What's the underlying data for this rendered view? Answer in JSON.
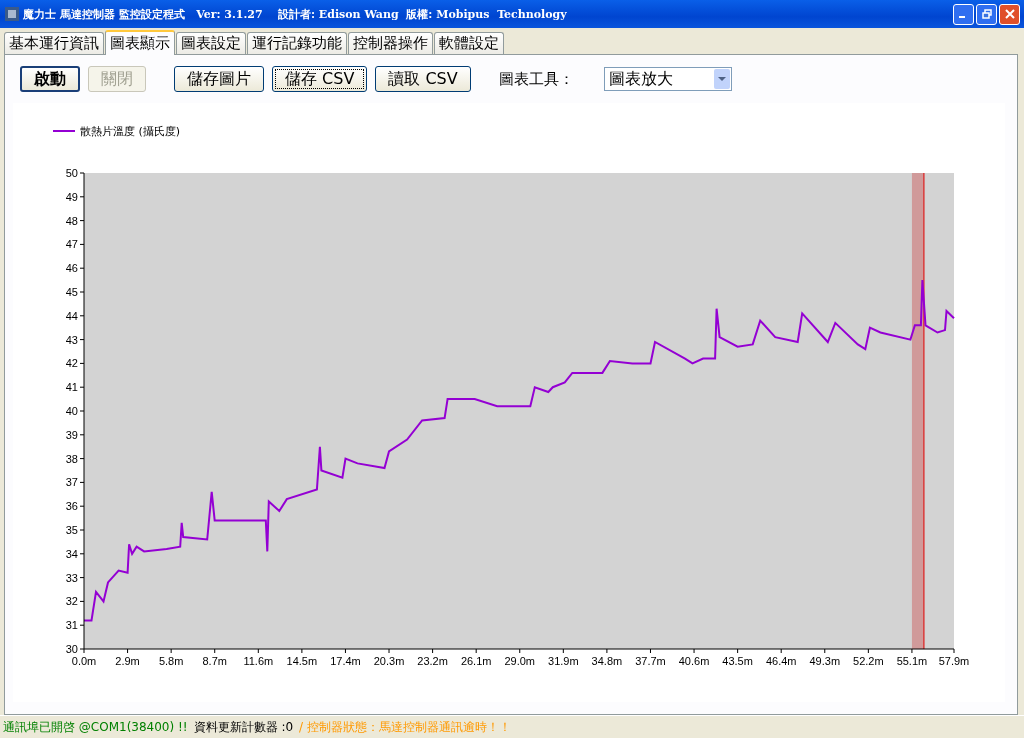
{
  "window": {
    "title": "魔力士 馬達控制器 監控設定程式   Ver: 3.1.27    設計者: Edison Wang  版權: Mobipus  Technology"
  },
  "tabs": [
    {
      "label": "基本運行資訊",
      "selected": false
    },
    {
      "label": "圖表顯示",
      "selected": true
    },
    {
      "label": "圖表設定",
      "selected": false
    },
    {
      "label": "運行記錄功能",
      "selected": false
    },
    {
      "label": "控制器操作",
      "selected": false
    },
    {
      "label": "軟體設定",
      "selected": false
    }
  ],
  "toolbar": {
    "run_buttons": [
      {
        "label": "啟動",
        "default": true,
        "disabled": false,
        "focused": false
      },
      {
        "label": "關閉",
        "default": false,
        "disabled": true,
        "focused": false
      }
    ],
    "file_buttons": [
      {
        "label": "儲存圖片",
        "default": false,
        "disabled": false,
        "focused": false
      },
      {
        "label": "儲存 CSV",
        "default": false,
        "disabled": false,
        "focused": true
      },
      {
        "label": "讀取 CSV",
        "default": false,
        "disabled": false,
        "focused": false
      }
    ],
    "tool_label": "圖表工具：",
    "tool_value": "圖表放大"
  },
  "chart": {
    "chart_data": {
      "type": "line",
      "xlim": [
        0,
        57.9
      ],
      "ylim": [
        30,
        50
      ],
      "yticks": [
        30,
        31,
        32,
        33,
        34,
        35,
        36,
        37,
        38,
        39,
        40,
        41,
        42,
        43,
        44,
        45,
        46,
        47,
        48,
        49,
        50
      ],
      "xticks": [
        {
          "value": 0,
          "label": "0.0m"
        },
        {
          "value": 2.9,
          "label": "2.9m"
        },
        {
          "value": 5.8,
          "label": "5.8m"
        },
        {
          "value": 8.7,
          "label": "8.7m"
        },
        {
          "value": 11.6,
          "label": "11.6m"
        },
        {
          "value": 14.5,
          "label": "14.5m"
        },
        {
          "value": 17.4,
          "label": "17.4m"
        },
        {
          "value": 20.3,
          "label": "20.3m"
        },
        {
          "value": 23.2,
          "label": "23.2m"
        },
        {
          "value": 26.1,
          "label": "26.1m"
        },
        {
          "value": 29.0,
          "label": "29.0m"
        },
        {
          "value": 31.9,
          "label": "31.9m"
        },
        {
          "value": 34.8,
          "label": "34.8m"
        },
        {
          "value": 37.7,
          "label": "37.7m"
        },
        {
          "value": 40.6,
          "label": "40.6m"
        },
        {
          "value": 43.5,
          "label": "43.5m"
        },
        {
          "value": 46.4,
          "label": "46.4m"
        },
        {
          "value": 49.3,
          "label": "49.3m"
        },
        {
          "value": 52.2,
          "label": "52.2m"
        },
        {
          "value": 55.1,
          "label": "55.1m"
        },
        {
          "value": 57.9,
          "label": "57.9m"
        }
      ],
      "x": [
        0,
        0.5,
        0.8,
        1.3,
        1.6,
        2.3,
        2.9,
        3.0,
        3.2,
        3.5,
        4.0,
        5.5,
        6.4,
        6.5,
        6.6,
        8.2,
        8.5,
        8.7,
        12.1,
        12.2,
        12.3,
        13.0,
        13.5,
        15.5,
        15.7,
        15.8,
        17.2,
        17.4,
        18.2,
        20.0,
        20.3,
        21.5,
        22.5,
        24.0,
        24.2,
        25.0,
        26.0,
        27.5,
        29.7,
        30.0,
        30.9,
        31.2,
        32.0,
        32.5,
        34.5,
        35.0,
        36.5,
        37.7,
        38.0,
        40.0,
        40.5,
        41.2,
        42.0,
        42.1,
        42.3,
        43.5,
        44.5,
        45.0,
        46.0,
        47.5,
        47.8,
        49.5,
        50.0,
        51.5,
        52.0,
        52.3,
        53.0,
        55.0,
        55.3,
        55.7,
        55.8,
        56.0,
        56.8,
        57.3,
        57.4,
        57.9
      ],
      "series": [
        {
          "name": "散熱片溫度 (攝氏度)",
          "color": "#9400d3",
          "values": [
            31.2,
            31.2,
            32.4,
            32.0,
            32.8,
            33.3,
            33.2,
            34.4,
            34.0,
            34.3,
            34.1,
            34.2,
            34.3,
            35.3,
            34.7,
            34.6,
            36.6,
            35.4,
            35.4,
            34.1,
            36.2,
            35.8,
            36.3,
            36.7,
            38.5,
            37.5,
            37.2,
            38.0,
            37.8,
            37.6,
            38.3,
            38.8,
            39.6,
            39.7,
            40.5,
            40.5,
            40.5,
            40.2,
            40.2,
            41.0,
            40.8,
            41.0,
            41.2,
            41.6,
            41.6,
            42.1,
            42.0,
            42.0,
            42.9,
            42.2,
            42.0,
            42.2,
            42.2,
            44.3,
            43.1,
            42.7,
            42.8,
            43.8,
            43.1,
            42.9,
            44.1,
            42.9,
            43.7,
            42.8,
            42.6,
            43.5,
            43.3,
            43.0,
            43.6,
            43.6,
            45.5,
            43.6,
            43.3,
            43.4,
            44.2,
            43.9
          ]
        }
      ],
      "bands": [
        {
          "axis": "x",
          "from": 55.1,
          "to": 55.9,
          "color": "#d09a9a"
        }
      ],
      "ref_lines": [
        {
          "axis": "x",
          "value": 55.9,
          "color": "#e00000"
        }
      ]
    }
  },
  "status_bar": [
    {
      "text": "通訊埠已開啓 @COM1(38400) !!",
      "kind": "ok"
    },
    {
      "text": "資料更新計數器 :0",
      "kind": "info"
    },
    {
      "text": "/ 控制器狀態：馬達控制器通訊逾時！！",
      "kind": "warning"
    }
  ]
}
